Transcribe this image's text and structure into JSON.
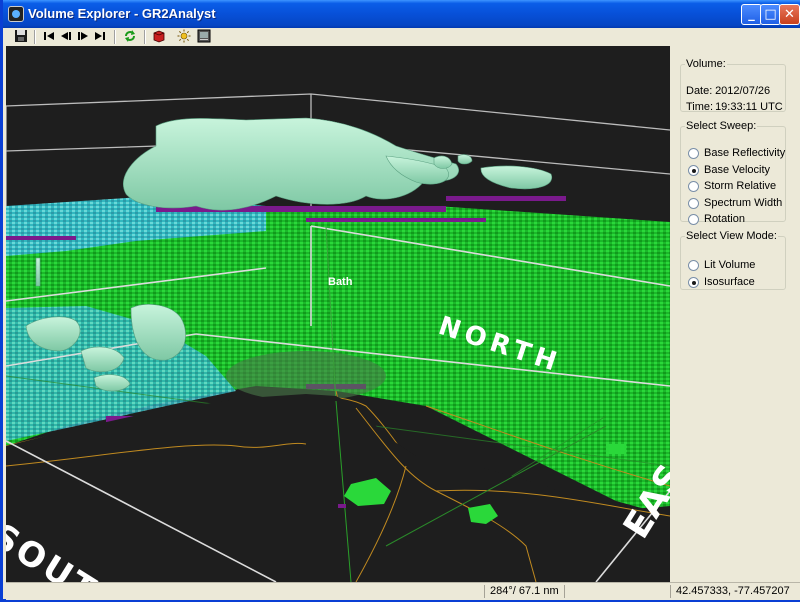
{
  "window": {
    "title": "Volume Explorer - GR2Analyst",
    "minimize_glyph": "_",
    "maximize_glyph": "□",
    "close_glyph": "✕"
  },
  "toolbar": {
    "save_icon": "save-icon",
    "first_frame_icon": "skip-back-icon",
    "prev_frame_icon": "step-back-icon",
    "next_frame_icon": "step-forward-icon",
    "last_frame_icon": "skip-forward-icon",
    "refresh_icon": "refresh-icon",
    "cube_icon": "cube-icon",
    "light_icon": "sun-icon",
    "display_icon": "display-icon"
  },
  "view": {
    "place_label": "Bath",
    "north_label": "NORTH",
    "south_label": "SOUTH",
    "east_label": "EAS"
  },
  "volume": {
    "legend": "Volume:",
    "date_key": "Date:",
    "date_value": "2012/07/26",
    "time_key": "Time:",
    "time_value": "19:33:11 UTC"
  },
  "sweep": {
    "legend": "Select Sweep:",
    "options": [
      {
        "label": "Base Reflectivity",
        "selected": false
      },
      {
        "label": "Base Velocity",
        "selected": true
      },
      {
        "label": "Storm Relative",
        "selected": false
      },
      {
        "label": "Spectrum Width",
        "selected": false
      },
      {
        "label": "Rotation",
        "selected": false
      }
    ]
  },
  "view_mode": {
    "legend": "Select View Mode:",
    "options": [
      {
        "label": "Lit Volume",
        "selected": false
      },
      {
        "label": "Isosurface",
        "selected": true
      }
    ]
  },
  "status": {
    "cell1": "",
    "bearing": "284°/ 67.1 nm",
    "cell3": "",
    "coords": "42.457333, -77.457207"
  },
  "colors": {
    "titlebar": "#0750d8",
    "chrome": "#ece9d8",
    "background3d": "#1e1e1e",
    "velocity_green": "#19c828",
    "isosurface": "#a8e8c8",
    "purple": "#7a1a8c",
    "cyan": "#48d0d0",
    "boundary": "#c08a20"
  }
}
